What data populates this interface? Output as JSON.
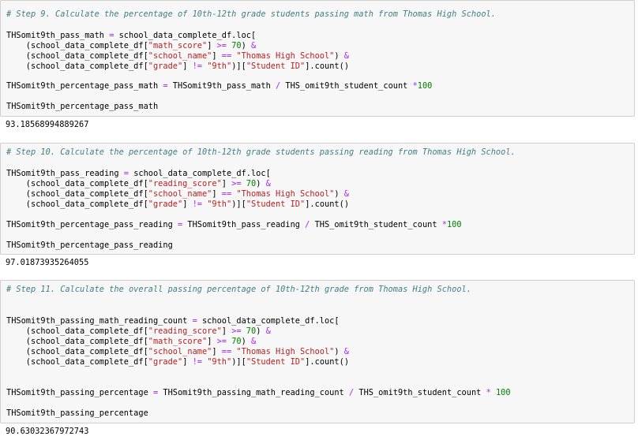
{
  "cells": [
    {
      "comment": "# Step 9. Calculate the percentage of 10th-12th grade students passing math from Thomas High School.",
      "code": {
        "l1_a": "THSomit9th_pass_math ",
        "l1_eq": "=",
        "l1_b": " school_data_complete_df.loc[",
        "l2_a": "    (school_data_complete_df[",
        "l2_s": "\"math_score\"",
        "l2_b": "] ",
        "l2_op": ">=",
        "l2_c": " ",
        "l2_n": "70",
        "l2_d": ") ",
        "l2_amp": "&",
        "l3_a": "    (school_data_complete_df[",
        "l3_s": "\"school_name\"",
        "l3_b": "] ",
        "l3_op": "==",
        "l3_c": " ",
        "l3_s2": "\"Thomas High School\"",
        "l3_d": ") ",
        "l3_amp": "&",
        "l4_a": "    (school_data_complete_df[",
        "l4_s": "\"grade\"",
        "l4_b": "] ",
        "l4_op": "!=",
        "l4_c": " ",
        "l4_s2": "\"9th\"",
        "l4_d": ")][",
        "l4_s3": "\"Student ID\"",
        "l4_e": "].count()",
        "l5_a": "THSomit9th_percentage_pass_math ",
        "l5_eq": "=",
        "l5_b": " THSomit9th_pass_math ",
        "l5_div": "/",
        "l5_c": " THS_omit9th_student_count ",
        "l5_mul": "*",
        "l5_n": "100",
        "l6": "THSomit9th_percentage_pass_math"
      },
      "output": "93.18568994889267"
    },
    {
      "comment": "# Step 10. Calculate the percentage of 10th-12th grade students passing reading from Thomas High School.",
      "code": {
        "l1_a": "THSomit9th_pass_reading ",
        "l1_eq": "=",
        "l1_b": " school_data_complete_df.loc[",
        "l2_a": "    (school_data_complete_df[",
        "l2_s": "\"reading_score\"",
        "l2_b": "] ",
        "l2_op": ">=",
        "l2_c": " ",
        "l2_n": "70",
        "l2_d": ") ",
        "l2_amp": "&",
        "l3_a": "    (school_data_complete_df[",
        "l3_s": "\"school_name\"",
        "l3_b": "] ",
        "l3_op": "==",
        "l3_c": " ",
        "l3_s2": "\"Thomas High School\"",
        "l3_d": ") ",
        "l3_amp": "&",
        "l4_a": "    (school_data_complete_df[",
        "l4_s": "\"grade\"",
        "l4_b": "] ",
        "l4_op": "!=",
        "l4_c": " ",
        "l4_s2": "\"9th\"",
        "l4_d": ")][",
        "l4_s3": "\"Student ID\"",
        "l4_e": "].count()",
        "l5_a": "THSomit9th_percentage_pass_reading ",
        "l5_eq": "=",
        "l5_b": " THSomit9th_pass_reading ",
        "l5_div": "/",
        "l5_c": " THS_omit9th_student_count ",
        "l5_mul": "*",
        "l5_n": "100",
        "l6": "THSomit9th_percentage_pass_reading"
      },
      "output": "97.01873935264055"
    },
    {
      "comment": "# Step 11. Calculate the overall passing percentage of 10th-12th grade from Thomas High School.",
      "code": {
        "l1_a": "THSomit9th_passing_math_reading_count ",
        "l1_eq": "=",
        "l1_b": " school_data_complete_df.loc[",
        "l2_a": "    (school_data_complete_df[",
        "l2_s": "\"reading_score\"",
        "l2_b": "] ",
        "l2_op": ">=",
        "l2_c": " ",
        "l2_n": "70",
        "l2_d": ") ",
        "l2_amp": "&",
        "l3_a": "    (school_data_complete_df[",
        "l3_s": "\"math_score\"",
        "l3_b": "] ",
        "l3_op": ">=",
        "l3_c": " ",
        "l3_n": "70",
        "l3_d": ") ",
        "l3_amp": "&",
        "l4_a": "    (school_data_complete_df[",
        "l4_s": "\"school_name\"",
        "l4_b": "] ",
        "l4_op": "==",
        "l4_c": " ",
        "l4_s2": "\"Thomas High School\"",
        "l4_d": ") ",
        "l4_amp": "&",
        "l5_a": "    (school_data_complete_df[",
        "l5_s": "\"grade\"",
        "l5_b": "] ",
        "l5_op": "!=",
        "l5_c": " ",
        "l5_s2": "\"9th\"",
        "l5_d": ")][",
        "l5_s3": "\"Student ID\"",
        "l5_e": "].count()",
        "l6_a": "THSomit9th_passing_percentage ",
        "l6_eq": "=",
        "l6_b": " THSomit9th_passing_math_reading_count ",
        "l6_div": "/",
        "l6_c": " THS_omit9th_student_count ",
        "l6_mul": "*",
        "l6_d": " ",
        "l6_n": "100",
        "l7": "THSomit9th_passing_percentage"
      },
      "output": "90.63032367972743"
    }
  ]
}
